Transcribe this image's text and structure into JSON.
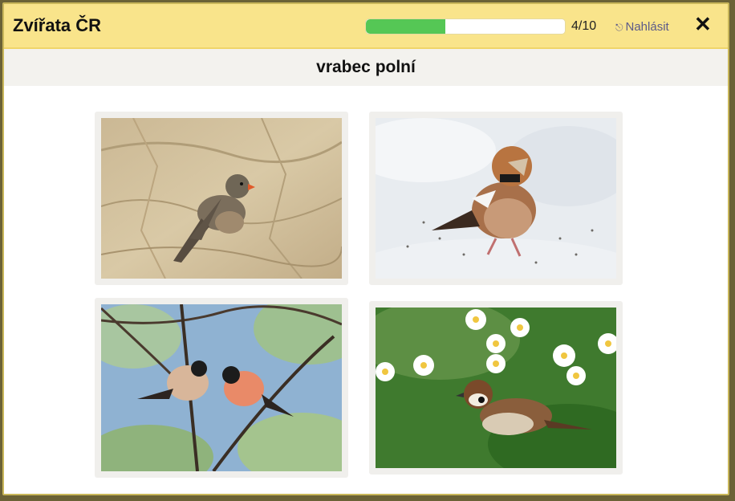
{
  "app": {
    "title": "Zvířata ČR"
  },
  "progress": {
    "value": 0.4,
    "counter": "4/10"
  },
  "report": {
    "icon": "flag-icon",
    "label": "Nahlásit"
  },
  "close": {
    "icon": "close-icon",
    "symbol": "✕"
  },
  "question": {
    "text": "vrabec polní"
  },
  "answers": [
    {
      "subject": "trumpeter finch on rock"
    },
    {
      "subject": "hawfinch on snow"
    },
    {
      "subject": "bullfinches on branches"
    },
    {
      "subject": "tree sparrow among daisies"
    }
  ],
  "colors": {
    "topbar": "#f9e48b",
    "progress_fill": "#55c755",
    "report_link": "#5c5a8a"
  }
}
